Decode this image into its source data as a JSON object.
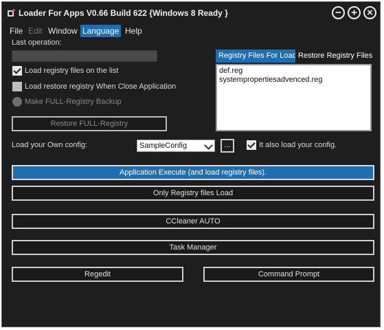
{
  "window": {
    "title": "Loader For Apps V0.66 Build 622 {Windows 8 Ready }",
    "controls": {
      "minimize": "−",
      "maximize": "+",
      "close": "×"
    }
  },
  "menu": {
    "file": "File",
    "edit": "Edit",
    "window": "Window",
    "language": "Language",
    "help": "Help"
  },
  "status": {
    "last_operation_label": "Last operation:",
    "progress": 0
  },
  "options": {
    "load_registry": "Load registry files on the list",
    "load_restore": "Load restore registry When Close Application",
    "make_backup": "Make FULL-Registry Backup"
  },
  "restore_button": "Restore FULL-Registry",
  "tabs": {
    "files_for_load": "Registry Files For Load",
    "restore_files": "Restore Registry Files"
  },
  "registry_files": [
    "def.reg",
    "systempropertiesadvenced.reg"
  ],
  "config": {
    "label": "Load your Own config:",
    "selected": "SampleConfig",
    "browse": "...",
    "also_load": "It also load your config."
  },
  "actions": {
    "execute": "Application Execute (and load registry files).",
    "registry_only": "Only Registry files Load",
    "ccleaner": "CCleaner AUTO",
    "task_manager": "Task Manager",
    "regedit": "Regedit",
    "command_prompt": "Command Prompt"
  },
  "colors": {
    "accent": "#1f6fb0",
    "background": "#1e1e1e"
  }
}
